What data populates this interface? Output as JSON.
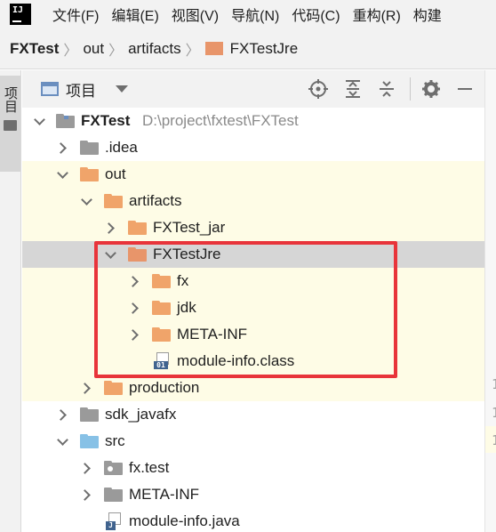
{
  "app": {
    "logo": "IJ"
  },
  "menubar": {
    "items": [
      "文件(F)",
      "编辑(E)",
      "视图(V)",
      "导航(N)",
      "代码(C)",
      "重构(R)",
      "构建"
    ]
  },
  "breadcrumb": {
    "items": [
      "FXTest",
      "out",
      "artifacts",
      "FXTestJre"
    ],
    "folder_color": "#e8956a"
  },
  "toolstrip": {
    "label": "项目"
  },
  "panel": {
    "title": "项目"
  },
  "gutter": {
    "numbers": [
      "1",
      "1",
      "1"
    ]
  },
  "tree": {
    "root": {
      "name": "FXTest",
      "path": "D:\\project\\fxtest\\FXTest"
    },
    "rows": [
      {
        "label": ".idea"
      },
      {
        "label": "out"
      },
      {
        "label": "artifacts"
      },
      {
        "label": "FXTest_jar"
      },
      {
        "label": "FXTestJre"
      },
      {
        "label": "fx"
      },
      {
        "label": "jdk"
      },
      {
        "label": "META-INF"
      },
      {
        "label": "module-info.class",
        "badge": "01"
      },
      {
        "label": "production"
      },
      {
        "label": "sdk_javafx"
      },
      {
        "label": "src"
      },
      {
        "label": "fx.test"
      },
      {
        "label": "META-INF"
      },
      {
        "label": "module-info.java",
        "badge": "J"
      }
    ]
  },
  "colors": {
    "excluded_folder": "#f0a46a",
    "regular_folder": "#9a9a9a",
    "source_folder": "#87c1e6",
    "selection": "#d6d6d6",
    "highlight_box": "#e8343a"
  }
}
